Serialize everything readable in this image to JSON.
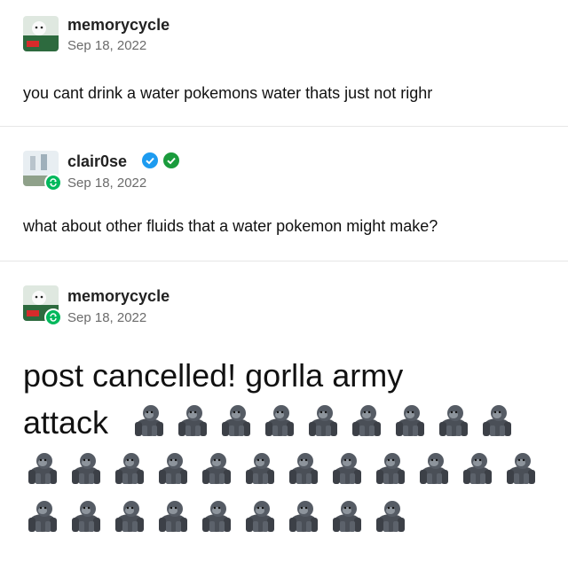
{
  "posts": [
    {
      "username": "memorycycle",
      "date": "Sep 18, 2022",
      "body": "you cant drink a water pokemons water thats just not righr"
    },
    {
      "username": "clair0se",
      "date": "Sep 18, 2022",
      "body": "what about other fluids that a water pokemon might make?"
    },
    {
      "username": "memorycycle",
      "date": "Sep 18, 2022",
      "body_line1": "post cancelled! gorlla army",
      "body_line2": "attack",
      "gorilla_icon": "gorilla-emoji",
      "gorilla_count": 30
    }
  ],
  "colors": {
    "reblog_green": "#00b85c",
    "verify_blue": "#1d9bf0",
    "verify_green": "#1a9b3c"
  }
}
